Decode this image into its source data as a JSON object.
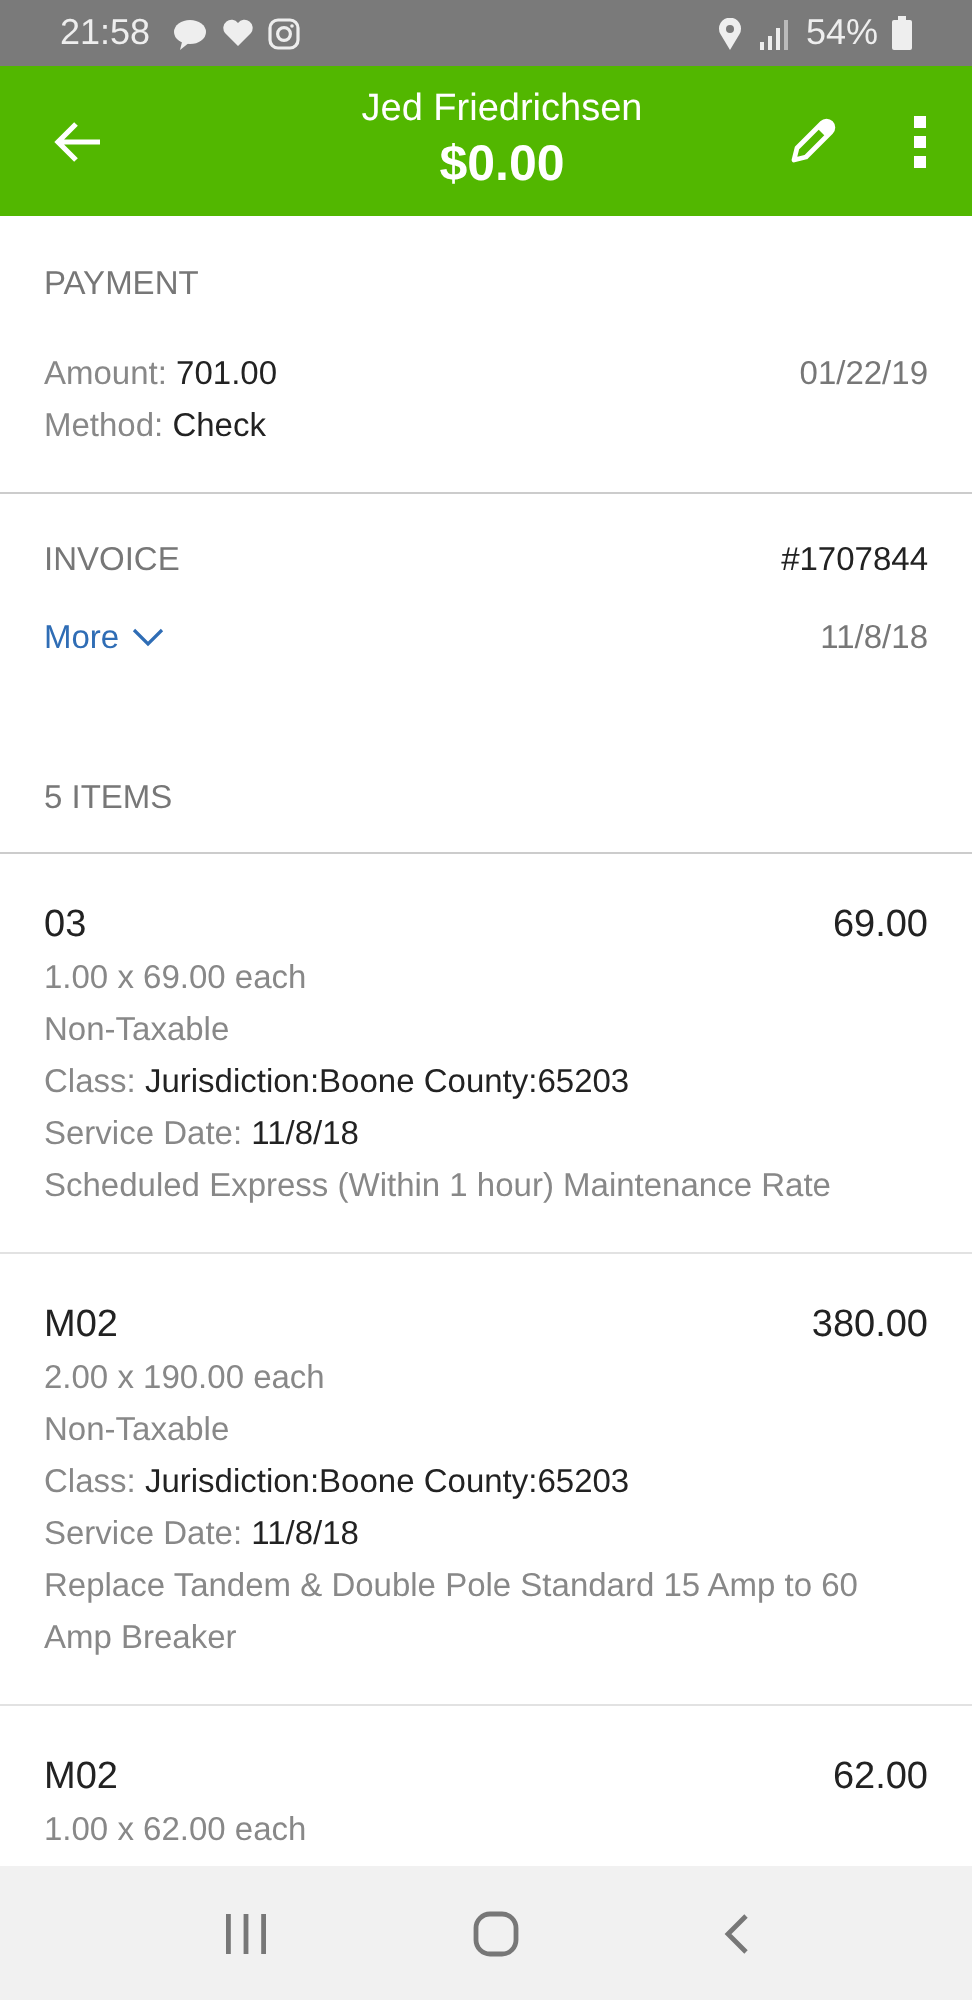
{
  "status_bar": {
    "time": "21:58",
    "battery": "54%"
  },
  "header": {
    "title": "Jed Friedrichsen",
    "amount": "$0.00"
  },
  "payment": {
    "heading": "PAYMENT",
    "date": "01/22/19",
    "fields": [
      {
        "label": "Amount:",
        "value": "701.00"
      },
      {
        "label": "Method:",
        "value": "Check"
      }
    ]
  },
  "invoice": {
    "heading": "INVOICE",
    "number": "#1707844",
    "more": "More",
    "date": "11/8/18"
  },
  "items_heading": "5  ITEMS",
  "items": [
    {
      "code": "03",
      "total": "69.00",
      "lines": [
        {
          "kind": "plain",
          "text": "1.00 x 69.00 each"
        },
        {
          "kind": "plain",
          "text": "Non-Taxable"
        },
        {
          "kind": "pair",
          "label": "Class:",
          "value": "Jurisdiction:Boone County:65203"
        },
        {
          "kind": "pair",
          "label": "Service Date:",
          "value": "11/8/18"
        },
        {
          "kind": "plain",
          "text": "Scheduled Express (Within 1 hour) Maintenance Rate"
        }
      ]
    },
    {
      "code": "M02",
      "total": "380.00",
      "lines": [
        {
          "kind": "plain",
          "text": "2.00 x 190.00 each"
        },
        {
          "kind": "plain",
          "text": "Non-Taxable"
        },
        {
          "kind": "pair",
          "label": "Class:",
          "value": "Jurisdiction:Boone County:65203"
        },
        {
          "kind": "pair",
          "label": "Service Date:",
          "value": "11/8/18"
        },
        {
          "kind": "plain",
          "text": "Replace Tandem & Double Pole Standard 15 Amp to 60 Amp Breaker"
        }
      ]
    },
    {
      "code": "M02",
      "total": "62.00",
      "lines": [
        {
          "kind": "plain",
          "text": "1.00 x 62.00 each"
        }
      ]
    }
  ]
}
